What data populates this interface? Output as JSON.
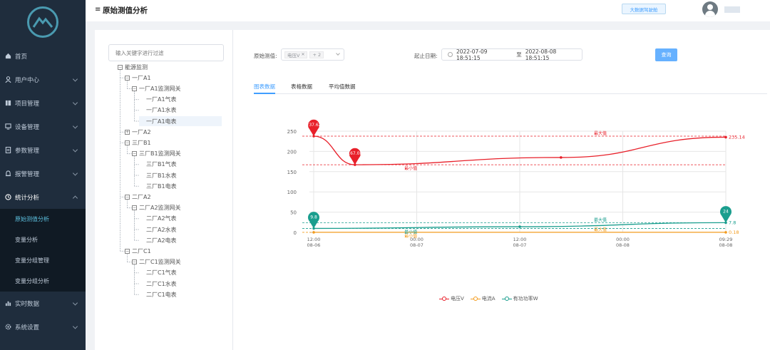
{
  "sidebar": {
    "items": [
      {
        "label": "首页",
        "icon": "home-icon"
      },
      {
        "label": "用户中心",
        "icon": "user-icon"
      },
      {
        "label": "项目管理",
        "icon": "project-icon"
      },
      {
        "label": "设备管理",
        "icon": "monitor-icon"
      },
      {
        "label": "参数管理",
        "icon": "document-icon"
      },
      {
        "label": "报警管理",
        "icon": "bell-icon"
      },
      {
        "label": "统计分析",
        "icon": "clock-icon"
      },
      {
        "label": "实时数据",
        "icon": "bar-chart-icon"
      },
      {
        "label": "系统设置",
        "icon": "gear-icon"
      }
    ],
    "sub_items": [
      "原始测值分析",
      "变量分析",
      "变量分组管理",
      "变量分组分析"
    ],
    "active_sub": "原始测值分析"
  },
  "header": {
    "title": "原始测值分析",
    "bigscreen_label": "大数据驾驶舱"
  },
  "tree": {
    "filter_placeholder": "输入关键字进行过滤",
    "nodes": [
      {
        "label": "能源监测",
        "level": 0,
        "expand": "−"
      },
      {
        "label": "一厂A1",
        "level": 1,
        "expand": "−"
      },
      {
        "label": "一厂A1监测网关",
        "level": 2,
        "expand": "−"
      },
      {
        "label": "一厂A1气表",
        "level": 3,
        "expand": ""
      },
      {
        "label": "一厂A1水表",
        "level": 3,
        "expand": ""
      },
      {
        "label": "一厂A1电表",
        "level": 3,
        "expand": "",
        "selected": true
      },
      {
        "label": "一厂A2",
        "level": 1,
        "expand": "+"
      },
      {
        "label": "三厂B1",
        "level": 1,
        "expand": "−"
      },
      {
        "label": "三厂B1监测网关",
        "level": 2,
        "expand": "−"
      },
      {
        "label": "三厂B1气表",
        "level": 3,
        "expand": ""
      },
      {
        "label": "三厂B1水表",
        "level": 3,
        "expand": ""
      },
      {
        "label": "三厂B1电表",
        "level": 3,
        "expand": ""
      },
      {
        "label": "二厂A2",
        "level": 1,
        "expand": "−"
      },
      {
        "label": "二厂A2监测网关",
        "level": 2,
        "expand": "−"
      },
      {
        "label": "二厂A2气表",
        "level": 3,
        "expand": ""
      },
      {
        "label": "二厂A2水表",
        "level": 3,
        "expand": ""
      },
      {
        "label": "二厂A2电表",
        "level": 3,
        "expand": ""
      },
      {
        "label": "二厂C1",
        "level": 1,
        "expand": "−"
      },
      {
        "label": "二厂C1监测网关",
        "level": 2,
        "expand": "−"
      },
      {
        "label": "二厂C1气表",
        "level": 3,
        "expand": ""
      },
      {
        "label": "二厂C1水表",
        "level": 3,
        "expand": ""
      },
      {
        "label": "二厂C1电表",
        "level": 3,
        "expand": ""
      }
    ]
  },
  "filters": {
    "raw_label": "原始测值:",
    "selected_tag": "电压V",
    "extra_tag": "+ 2",
    "date_label": "起止日期:",
    "start_date": "2022-07-09 18:51:15",
    "date_sep": "至",
    "end_date": "2022-08-08 18:51:15",
    "query_label": "查询"
  },
  "tabs": [
    "图表数据",
    "表格数据",
    "平均值数据"
  ],
  "colors": {
    "voltage": "#e8202a",
    "current": "#f39c1f",
    "power": "#1a9e8e",
    "accent": "#409eff",
    "sidebar": "#1f2d3d"
  },
  "chart_data": {
    "type": "line",
    "x_ticks": [
      {
        "time": "12:00",
        "date": "08-06"
      },
      {
        "time": "00:00",
        "date": "08-07"
      },
      {
        "time": "12:00",
        "date": "08-07"
      },
      {
        "time": "00:00",
        "date": "08-08"
      },
      {
        "time": "09:29",
        "date": "08-08"
      }
    ],
    "ylim": [
      0,
      250
    ],
    "y_ticks": [
      "0",
      "50",
      "100",
      "150",
      "200",
      "250"
    ],
    "max_label": "最大值",
    "min_label": "最小值",
    "series": [
      {
        "name": "电压V",
        "points": [
          [
            0.0,
            237.62
          ],
          [
            0.1,
            167.08
          ],
          [
            0.6,
            185
          ],
          [
            1.0,
            235.14
          ]
        ],
        "max_pin": "237.62",
        "min_pin": "167.08",
        "end_label": "235.14"
      },
      {
        "name": "电流A",
        "points": [
          [
            0.0,
            0.16
          ],
          [
            1.0,
            0.18
          ]
        ],
        "max_pin": "",
        "min_pin": "",
        "end_label": "0.18"
      },
      {
        "name": "有功功率W",
        "points": [
          [
            0.0,
            9.8
          ],
          [
            0.5,
            14
          ],
          [
            1.0,
            24
          ]
        ],
        "max_pin": "24",
        "min_pin": "9.8",
        "end_label": "7.8"
      }
    ]
  }
}
